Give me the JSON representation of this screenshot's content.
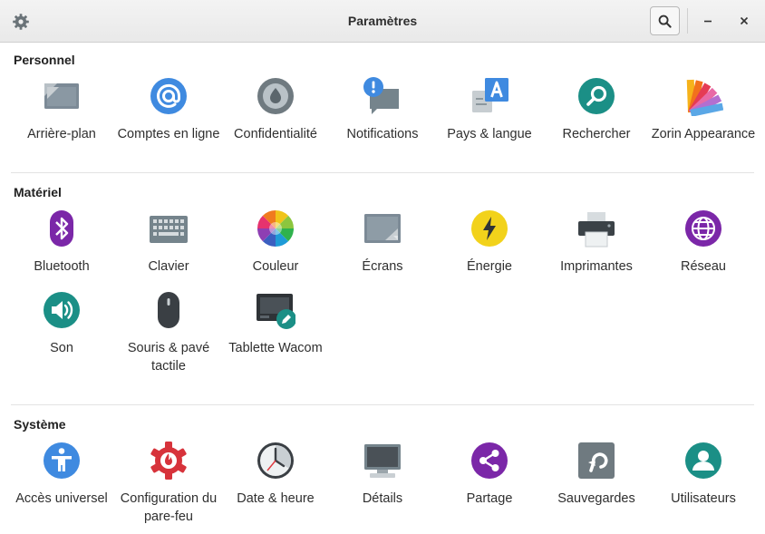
{
  "window": {
    "title": "Paramètres"
  },
  "sections": [
    {
      "title": "Personnel",
      "items": [
        {
          "label": "Arrière-plan",
          "icon": "background-icon"
        },
        {
          "label": "Comptes en ligne",
          "icon": "online-accounts-icon"
        },
        {
          "label": "Confidentialité",
          "icon": "privacy-icon"
        },
        {
          "label": "Notifications",
          "icon": "notifications-icon"
        },
        {
          "label": "Pays & langue",
          "icon": "region-language-icon"
        },
        {
          "label": "Rechercher",
          "icon": "search-icon"
        },
        {
          "label": "Zorin Appearance",
          "icon": "appearance-icon"
        }
      ]
    },
    {
      "title": "Matériel",
      "items": [
        {
          "label": "Bluetooth",
          "icon": "bluetooth-icon"
        },
        {
          "label": "Clavier",
          "icon": "keyboard-icon"
        },
        {
          "label": "Couleur",
          "icon": "color-wheel-icon"
        },
        {
          "label": "Écrans",
          "icon": "displays-icon"
        },
        {
          "label": "Énergie",
          "icon": "power-icon"
        },
        {
          "label": "Imprimantes",
          "icon": "printer-icon"
        },
        {
          "label": "Réseau",
          "icon": "network-globe-icon"
        },
        {
          "label": "Son",
          "icon": "sound-icon"
        },
        {
          "label": "Souris & pavé tactile",
          "icon": "mouse-icon"
        },
        {
          "label": "Tablette Wacom",
          "icon": "wacom-tablet-icon"
        }
      ]
    },
    {
      "title": "Système",
      "items": [
        {
          "label": "Accès universel",
          "icon": "accessibility-icon"
        },
        {
          "label": "Configuration du pare-feu",
          "icon": "firewall-icon"
        },
        {
          "label": "Date & heure",
          "icon": "clock-icon"
        },
        {
          "label": "Détails",
          "icon": "details-monitor-icon"
        },
        {
          "label": "Partage",
          "icon": "sharing-icon"
        },
        {
          "label": "Sauvegardes",
          "icon": "backups-icon"
        },
        {
          "label": "Utilisateurs",
          "icon": "users-icon"
        }
      ]
    }
  ],
  "colors": {
    "blue": "#3f8ae0",
    "teal": "#1b8f86",
    "purple": "#7b27a8",
    "yellow": "#f2d21b",
    "red": "#e0353c",
    "gray": "#6f7a80"
  }
}
